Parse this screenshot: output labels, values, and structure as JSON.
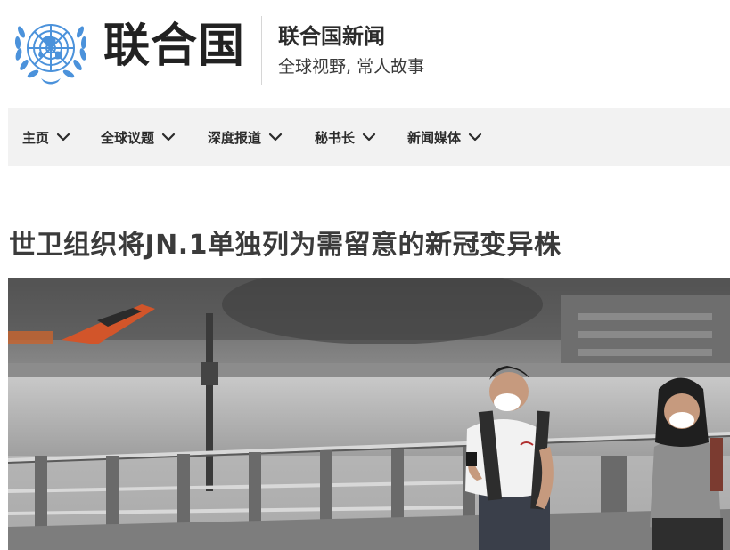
{
  "header": {
    "org_name": "联合国",
    "site_title": "联合国新闻",
    "site_tagline": "全球视野, 常人故事"
  },
  "nav": {
    "items": [
      {
        "label": "主页"
      },
      {
        "label": "全球议题"
      },
      {
        "label": "深度报道"
      },
      {
        "label": "秘书长"
      },
      {
        "label": "新闻媒体"
      }
    ]
  },
  "article": {
    "headline": "世卫组织将JN.1单独列为需留意的新冠变异株"
  },
  "colors": {
    "un_blue": "#4b92db",
    "nav_bg": "#f2f2f2",
    "text_dark": "#2b2b2b"
  },
  "icons": {
    "logo": "un-emblem-icon",
    "nav_chevron": "chevron-down-icon"
  }
}
